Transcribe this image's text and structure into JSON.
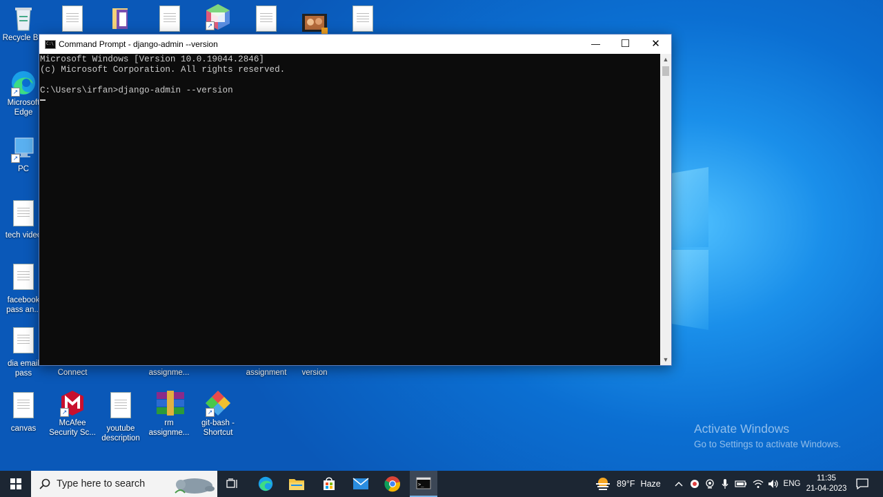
{
  "desktop": {
    "top_icons": [
      {
        "name": "recycle-bin",
        "label": "Recycle Bin"
      },
      {
        "name": "document",
        "label": ""
      },
      {
        "name": "folder",
        "label": ""
      },
      {
        "name": "document",
        "label": ""
      },
      {
        "name": "app-cube",
        "label": ""
      },
      {
        "name": "document",
        "label": ""
      },
      {
        "name": "video",
        "label": ""
      },
      {
        "name": "document",
        "label": ""
      }
    ],
    "left_icons": [
      {
        "label": "Microsoft Edge"
      },
      {
        "label": "PC"
      },
      {
        "label": "tech video"
      },
      {
        "label": "facebook pass an..."
      },
      {
        "label": "dia email pass"
      },
      {
        "label": "canvas"
      }
    ],
    "row2_partial": [
      {
        "label": "Connect"
      },
      {
        "label": "assignme..."
      },
      {
        "label": "assignment"
      },
      {
        "label": "version"
      }
    ],
    "bottom_icons": [
      {
        "label": "McAfee Security Sc..."
      },
      {
        "label": "youtube description"
      },
      {
        "label": "rm assignme..."
      },
      {
        "label": "git-bash - Shortcut"
      }
    ]
  },
  "cmd": {
    "title": "Command Prompt - django-admin  --version",
    "minimize": "—",
    "maximize": "☐",
    "close": "✕",
    "lines": [
      "Microsoft Windows [Version 10.0.19044.2846]",
      "(c) Microsoft Corporation. All rights reserved.",
      "",
      "C:\\Users\\irfan>django-admin --version"
    ]
  },
  "watermark": {
    "title": "Activate Windows",
    "subtitle": "Go to Settings to activate Windows."
  },
  "taskbar": {
    "search_placeholder": "Type here to search",
    "weather_temp": "89°F",
    "weather_desc": "Haze",
    "language": "ENG",
    "time": "11:35",
    "date": "21-04-2023"
  }
}
